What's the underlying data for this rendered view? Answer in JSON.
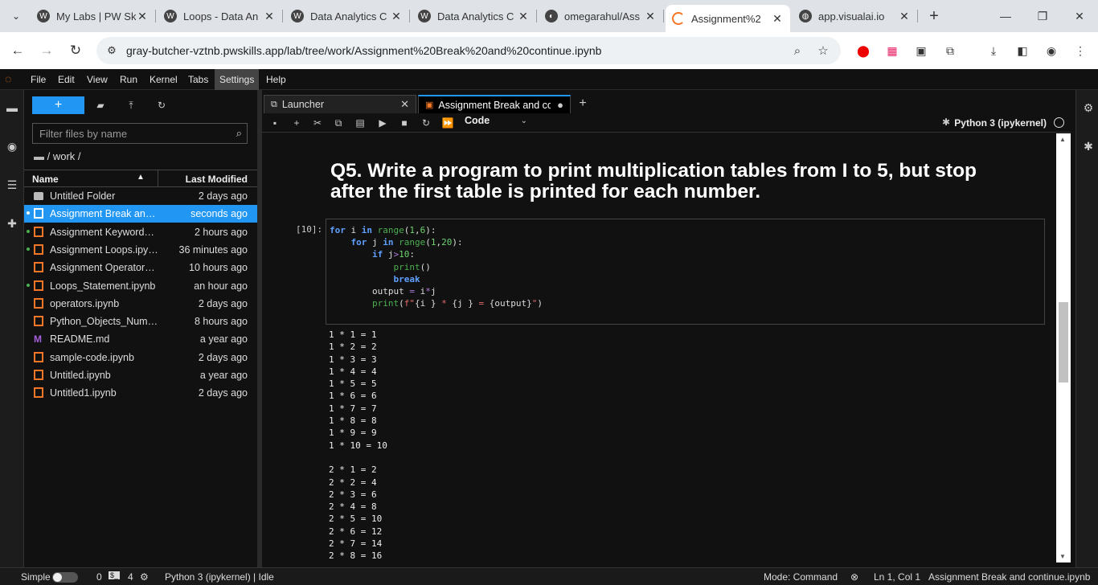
{
  "browser": {
    "tabs": [
      {
        "title": "My Labs | PW Sk",
        "icon": "wordpress-icon"
      },
      {
        "title": "Loops - Data An",
        "icon": "wordpress-icon"
      },
      {
        "title": "Data Analytics C",
        "icon": "wordpress-icon"
      },
      {
        "title": "Data Analytics C",
        "icon": "wordpress-icon"
      },
      {
        "title": "omegarahul/Ass",
        "icon": "github-icon"
      },
      {
        "title": "Assignment%2",
        "icon": "jupyter-icon"
      },
      {
        "title": "app.visualai.io",
        "icon": "globe-icon"
      }
    ],
    "url": "gray-butcher-vztnb.pwskills.app/lab/tree/work/Assignment%20Break%20and%20continue.ipynb"
  },
  "menubar": {
    "items": [
      "File",
      "Edit",
      "View",
      "Run",
      "Kernel",
      "Tabs",
      "Settings",
      "Help"
    ]
  },
  "filebrowser": {
    "filter_placeholder": "Filter files by name",
    "breadcrumb": "/ work /",
    "col_name": "Name",
    "col_modified": "Last Modified",
    "files": [
      {
        "name": "Untitled Folder",
        "modified": "2 days ago",
        "type": "folder",
        "running": false,
        "selected": false
      },
      {
        "name": "Assignment Break and c...",
        "modified": "seconds ago",
        "type": "notebook",
        "running": true,
        "selected": true
      },
      {
        "name": "Assignment Keywords.i...",
        "modified": "2 hours ago",
        "type": "notebook",
        "running": true,
        "selected": false
      },
      {
        "name": "Assignment Loops.ipynb",
        "modified": "36 minutes ago",
        "type": "notebook",
        "running": true,
        "selected": false
      },
      {
        "name": "Assignment Operators.i...",
        "modified": "10 hours ago",
        "type": "notebook",
        "running": false,
        "selected": false
      },
      {
        "name": "Loops_Statement.ipynb",
        "modified": "an hour ago",
        "type": "notebook",
        "running": true,
        "selected": false
      },
      {
        "name": "operators.ipynb",
        "modified": "2 days ago",
        "type": "notebook",
        "running": false,
        "selected": false
      },
      {
        "name": "Python_Objects_Numb...",
        "modified": "8 hours ago",
        "type": "notebook",
        "running": false,
        "selected": false
      },
      {
        "name": "README.md",
        "modified": "a year ago",
        "type": "markdown",
        "running": false,
        "selected": false
      },
      {
        "name": "sample-code.ipynb",
        "modified": "2 days ago",
        "type": "notebook",
        "running": false,
        "selected": false
      },
      {
        "name": "Untitled.ipynb",
        "modified": "a year ago",
        "type": "notebook",
        "running": false,
        "selected": false
      },
      {
        "name": "Untitled1.ipynb",
        "modified": "2 days ago",
        "type": "notebook",
        "running": false,
        "selected": false
      }
    ]
  },
  "doc_tabs": {
    "launcher": "Launcher",
    "notebook": "Assignment Break and contir"
  },
  "toolbar": {
    "cell_type": "Code",
    "kernel": "Python 3 (ipykernel)"
  },
  "notebook": {
    "heading": "Q5. Write a program to print multiplication tables from I to 5, but stop after the first table is printed for each number.",
    "prompt": "[10]:",
    "output_lines": [
      "1 * 1 = 1",
      "1 * 2 = 2",
      "1 * 3 = 3",
      "1 * 4 = 4",
      "1 * 5 = 5",
      "1 * 6 = 6",
      "1 * 7 = 7",
      "1 * 8 = 8",
      "1 * 9 = 9",
      "1 * 10 = 10",
      "",
      "2 * 1 = 2",
      "2 * 2 = 4",
      "2 * 3 = 6",
      "2 * 4 = 8",
      "2 * 5 = 10",
      "2 * 6 = 12",
      "2 * 7 = 14",
      "2 * 8 = 16"
    ]
  },
  "statusbar": {
    "mode_label": "Simple",
    "terminals": "0",
    "kernels": "4",
    "kernel_status": "Python 3 (ipykernel) | Idle",
    "command_mode": "Mode: Command",
    "position": "Ln 1, Col 1",
    "filename": "Assignment Break and continue.ipynb"
  },
  "colors": {
    "accent": "#2196f3",
    "jupyter_orange": "#f37726"
  }
}
